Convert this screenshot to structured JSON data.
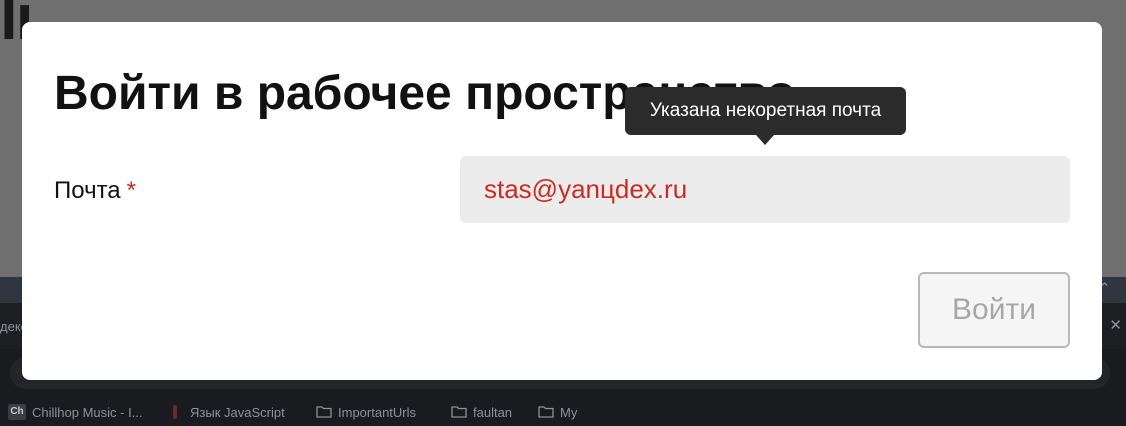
{
  "background": {
    "logo_text": "li",
    "tab_fragment": "деко",
    "bookmarks": [
      {
        "label": "Chillhop Music - I...",
        "icon": "chillhop-favicon"
      },
      {
        "label": "Язык JavaScript",
        "icon": "javascript-favicon"
      },
      {
        "label": "ImportantUrls",
        "icon": "folder-icon"
      },
      {
        "label": "faultan",
        "icon": "folder-icon"
      },
      {
        "label": "My",
        "icon": "folder-icon"
      }
    ]
  },
  "modal": {
    "title": "Войти в рабочее пространство",
    "email_label": "Почта",
    "required_mark": "*",
    "email_value": "stas@yanцdex.ru",
    "tooltip_text": "Указана некоретная почта",
    "submit_label": "Войти"
  },
  "colors": {
    "error": "#cc2b22",
    "tooltip_bg": "#2b2b2b",
    "input_bg": "#ececec",
    "overlay": "#6f6f6f"
  }
}
